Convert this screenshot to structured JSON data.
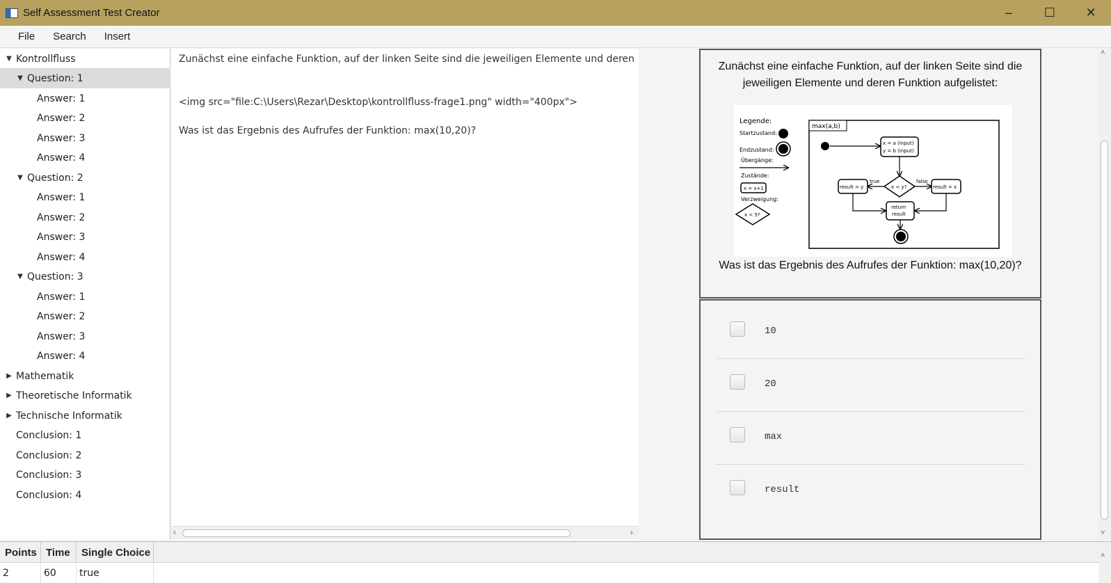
{
  "window": {
    "title": "Self Assessment Test Creator",
    "min_icon": "minimize-icon",
    "max_icon": "maximize-icon",
    "close_icon": "close-icon"
  },
  "menu": [
    "File",
    "Search",
    "Insert"
  ],
  "tree": {
    "root": "Kontrollfluss",
    "questions": [
      {
        "label": "Question: 1",
        "answers": [
          "Answer: 1",
          "Answer: 2",
          "Answer: 3",
          "Answer: 4"
        ]
      },
      {
        "label": "Question: 2",
        "answers": [
          "Answer: 1",
          "Answer: 2",
          "Answer: 3",
          "Answer: 4"
        ]
      },
      {
        "label": "Question: 3",
        "answers": [
          "Answer: 1",
          "Answer: 2",
          "Answer: 3",
          "Answer: 4"
        ]
      }
    ],
    "collapsed": [
      "Mathematik",
      "Theoretische Informatik",
      "Technische Informatik"
    ],
    "conclusions": [
      "Conclusion: 1",
      "Conclusion: 2",
      "Conclusion: 3",
      "Conclusion: 4"
    ]
  },
  "editor": {
    "line1": "Zunächst eine einfache Funktion, auf der linken Seite sind die jeweiligen Elemente und deren Funktion aufgelistet:",
    "line2": "<img src=\"file:C:\\Users\\Rezar\\Desktop\\kontrollfluss-frage1.png\" width=\"400px\">",
    "line3": "Was ist das Ergebnis des Aufrufes der Funktion: max(10,20)?"
  },
  "preview": {
    "intro_line1": "Zunächst eine einfache Funktion, auf der linken Seite sind die",
    "intro_line2": "jeweiligen Elemente und deren Funktion aufgelistet:",
    "question": "Was ist das Ergebnis des Aufrufes der Funktion: max(10,20)?",
    "diagram": {
      "legend_title": "Legende:",
      "legend_start": "Startzustand:",
      "legend_end": "Endzustand:",
      "legend_transitions": "Übergänge:",
      "legend_states": "Zustände:",
      "legend_state_example": "x = x+1",
      "legend_branch": "Verzweigung:",
      "legend_branch_example": "x < 5?",
      "frame_label": "max(a,b)",
      "assign_1": "x = a (input)",
      "assign_2": "y = b (input)",
      "decision": "x < y?",
      "true_label": "true",
      "false_label": "false",
      "result_y": "result = y",
      "result_x": "result = x",
      "return_1": "return",
      "return_2": "result"
    },
    "answers": [
      "10",
      "20",
      "max",
      "result"
    ]
  },
  "properties": {
    "headers": [
      "Points",
      "Time",
      "Single Choice"
    ],
    "values": [
      "2",
      "60",
      "true"
    ]
  }
}
